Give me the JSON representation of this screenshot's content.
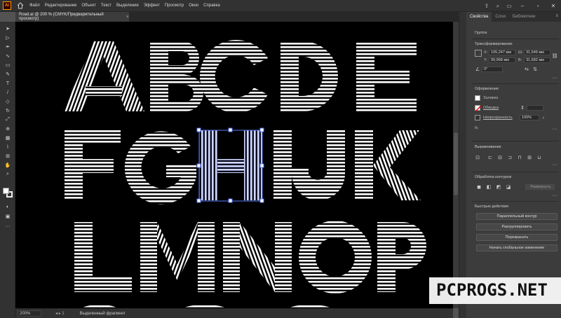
{
  "app": {
    "logo_text": "Ai",
    "menu": [
      "Файл",
      "Редактирование",
      "Объект",
      "Текст",
      "Выделение",
      "Эффект",
      "Просмотр",
      "Окно",
      "Справка"
    ]
  },
  "document": {
    "tab_title": "Road.ai @ 200 % (CMYK/Предварительный просмотр)",
    "letters": [
      "A",
      "B",
      "C",
      "D",
      "E",
      "F",
      "G",
      "H",
      "I",
      "J",
      "K",
      "L",
      "M",
      "N",
      "O",
      "P"
    ],
    "selected_letter": "H"
  },
  "status": {
    "zoom": "200%",
    "artboard_nav": "1",
    "mode_text": "Выделенный фрагмент"
  },
  "panel": {
    "tabs": [
      "Свойства",
      "Слои",
      "Библиотеки"
    ],
    "active_tab": "Свойства",
    "selection_type": "Группа",
    "transform": {
      "title": "Трансформирование",
      "x_label": "X:",
      "x_value": "105,247 мм",
      "y_label": "Y:",
      "y_value": "99,968 мм",
      "w_label": "Ш:",
      "w_value": "31,549 мм",
      "h_label": "В:",
      "h_value": "31,682 мм",
      "angle_value": "0°"
    },
    "appearance": {
      "title": "Оформление",
      "fill_label": "Заливка",
      "stroke_label": "Обводка",
      "opacity_label": "Непрозрачность",
      "opacity_value": "100%",
      "fx_label": "fx."
    },
    "align": {
      "title": "Выравнивание"
    },
    "pathfinder": {
      "title": "Обработка контуров",
      "expand_label": "Развернуть"
    },
    "quick_actions": {
      "title": "Быстрые действия",
      "buttons": [
        "Параллельный контур",
        "Разгруппировать",
        "Перекрасить",
        "Начать глобальное изменение"
      ]
    }
  },
  "watermark": "PCPROGS.NET",
  "colors": {
    "accent": "#ff9a00",
    "selection": "#5b7bff",
    "canvas": "#000000"
  }
}
